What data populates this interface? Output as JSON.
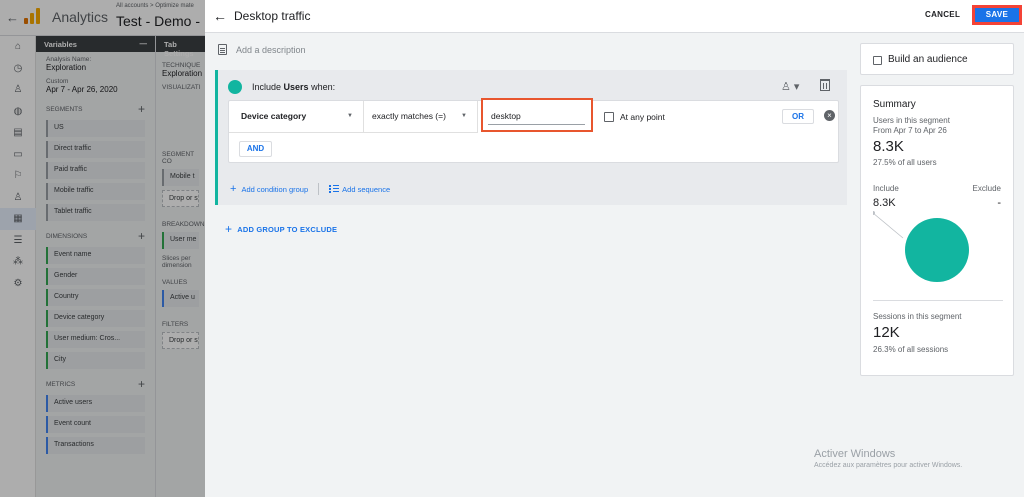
{
  "background_app": {
    "app_title": "Analytics",
    "breadcrumb": "All accounts > Optimize mate",
    "property_name": "Test - Demo - Ec",
    "variables": {
      "header": "Variables",
      "exploration_name_label": "Analysis Name:",
      "exploration_name": "Exploration",
      "date_label": "Custom",
      "date_range": "Apr 7 - Apr 26, 2020",
      "segments_label": "SEGMENTS",
      "segments": [
        "US",
        "Direct traffic",
        "Paid traffic",
        "Mobile traffic",
        "Tablet traffic"
      ],
      "dimensions_label": "DIMENSIONS",
      "dimensions": [
        "Event name",
        "Gender",
        "Country",
        "Device category",
        "User medium: Cros...",
        "City"
      ],
      "metrics_label": "METRICS",
      "metrics": [
        "Active users",
        "Event count",
        "Transactions"
      ]
    },
    "tab_settings": {
      "header": "Tab Settings",
      "technique_label": "TECHNIQUE",
      "technique": "Exploration",
      "visualization_label": "VISUALIZATI",
      "segment_label": "SEGMENT CO",
      "segment_chip": "Mobile t",
      "drop_hint": "Drop or s",
      "breakdown_label": "BREAKDOWN",
      "breakdown_chip": "User me",
      "slices_label": "Slices per dimension",
      "values_label": "VALUES",
      "values_chip": "Active u",
      "filters_label": "FILTERS",
      "filters_drop": "Drop or sel"
    }
  },
  "editor": {
    "title": "Desktop traffic",
    "cancel_label": "CANCEL",
    "save_label": "SAVE",
    "description_placeholder": "Add a description",
    "include_prefix": "Include",
    "include_scope": "Users",
    "include_suffix": "when:",
    "condition": {
      "dimension": "Device category",
      "operator": "exactly matches (=)",
      "value": "desktop",
      "at_any_point_label": "At any point",
      "at_any_point_checked": false,
      "or_label": "OR",
      "and_label": "AND"
    },
    "add_condition_group": "Add condition group",
    "add_sequence": "Add sequence",
    "add_group_to_exclude": "ADD GROUP TO EXCLUDE"
  },
  "sidebar": {
    "build_audience_label": "Build an audience",
    "build_audience_checked": false,
    "summary": {
      "title": "Summary",
      "users_label": "Users in this segment",
      "users_range": "From Apr 7 to Apr 26",
      "users_value": "8.3K",
      "users_pct": "27.5% of all users",
      "include_label": "Include",
      "exclude_label": "Exclude",
      "include_value": "8.3K",
      "exclude_value": "-",
      "sessions_label": "Sessions in this segment",
      "sessions_value": "12K",
      "sessions_pct": "26.3% of all sessions"
    }
  },
  "os_watermark": {
    "line1": "Activer Windows",
    "line2": "Accédez aux paramètres pour activer Windows."
  },
  "colors": {
    "accent": "#1a73e8",
    "segment_teal": "#12b5a0",
    "highlight_red": "#e8562e"
  }
}
